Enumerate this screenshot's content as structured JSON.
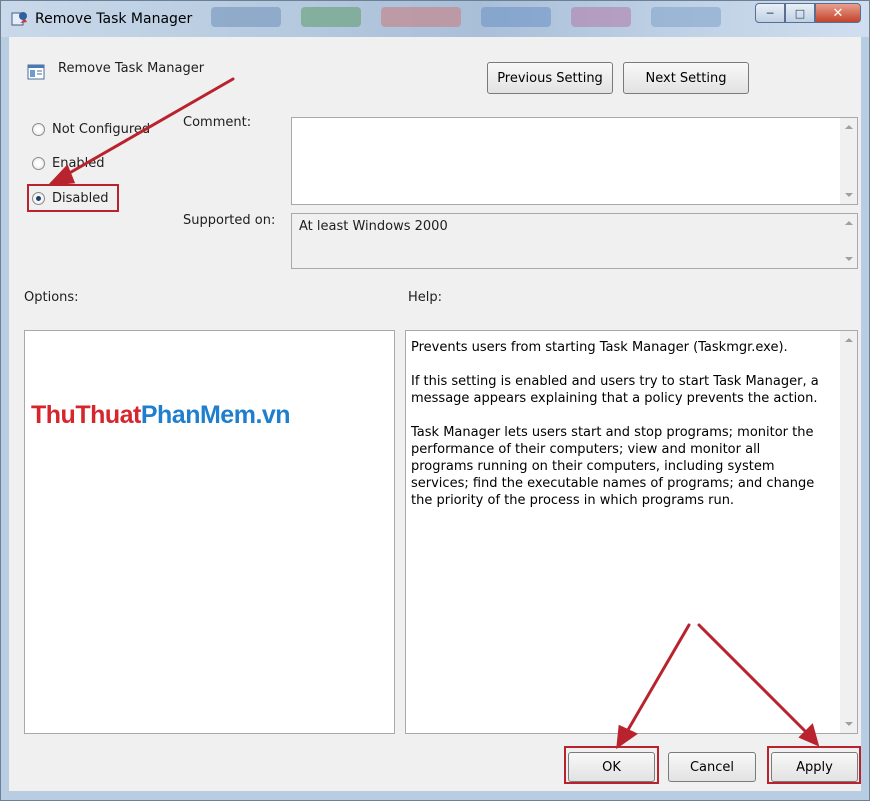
{
  "window": {
    "title": "Remove Task Manager"
  },
  "header": {
    "policy_title": "Remove Task Manager",
    "previous_setting": "Previous Setting",
    "next_setting": "Next Setting"
  },
  "state": {
    "options": [
      "Not Configured",
      "Enabled",
      "Disabled"
    ],
    "selected": "Disabled"
  },
  "comment": {
    "label": "Comment:",
    "value": ""
  },
  "supported": {
    "label": "Supported on:",
    "value": "At least Windows 2000"
  },
  "options_panel": {
    "label": "Options:",
    "watermark_part1": "ThuThuat",
    "watermark_part2": "PhanMem",
    "watermark_part3": ".vn"
  },
  "help_panel": {
    "label": "Help:",
    "paragraphs": [
      "Prevents users from starting Task Manager (Taskmgr.exe).",
      "If this setting is enabled and users try to start Task Manager, a message appears explaining that a policy prevents the action.",
      "Task Manager lets users start and stop programs; monitor the performance of their computers; view and monitor all programs running on their computers, including system services; find the executable names of programs; and change the priority of the process in which programs run."
    ]
  },
  "footer": {
    "ok": "OK",
    "cancel": "Cancel",
    "apply": "Apply"
  },
  "colors": {
    "annotation_red": "#b8232d",
    "watermark_red": "#d5262e",
    "watermark_blue": "#1f7fce"
  }
}
